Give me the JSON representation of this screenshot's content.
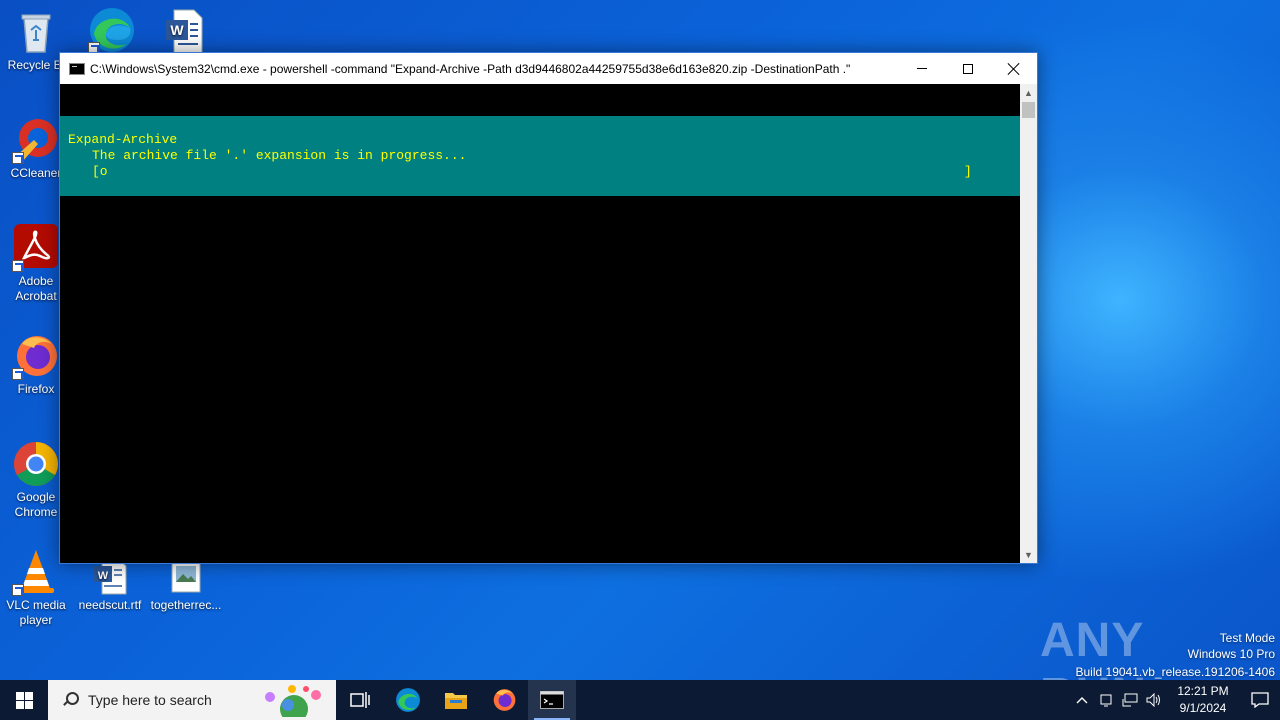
{
  "desktop": {
    "icons": [
      {
        "label": "Recycle Bin",
        "display": "Recycle Bi"
      },
      {
        "label": "Microsoft Edge",
        "display": ""
      },
      {
        "label": "Word document",
        "display": ""
      },
      {
        "label": "CCleaner",
        "display": "CCleaner"
      },
      {
        "label": "Adobe Acrobat",
        "display": "Adobe\nAcrobat"
      },
      {
        "label": "Firefox",
        "display": "Firefox"
      },
      {
        "label": "Google Chrome",
        "display": "Google\nChrome"
      },
      {
        "label": "VLC media player",
        "display": "VLC media\nplayer"
      },
      {
        "label": "needscut.rtf",
        "display": "needscut.rtf"
      },
      {
        "label": "togetherrec...",
        "display": "togetherrec..."
      }
    ]
  },
  "window": {
    "title": "C:\\Windows\\System32\\cmd.exe - powershell  -command \"Expand-Archive -Path d3d9446802a44259755d38e6d163e820.zip -DestinationPath .\"",
    "controls": {
      "minimize": "Minimize",
      "maximize": "Maximize",
      "close": "Close"
    }
  },
  "console": {
    "progress_title": "Expand-Archive",
    "progress_status": "The archive file '.' expansion is in progress...",
    "progress_bar_left": "[o",
    "progress_bar_right": "]",
    "progress_fraction": 0.0
  },
  "watermark": {
    "brand": "ANY RUN",
    "line1": "Test Mode",
    "line2": "Windows 10 Pro",
    "line3": "Build 19041.vb_release.191206-1406"
  },
  "taskbar": {
    "search_placeholder": "Type here to search",
    "apps": [
      "Task View",
      "Microsoft Edge",
      "File Explorer",
      "Firefox",
      "Command Prompt"
    ],
    "clock_time": "12:21 PM",
    "clock_date": "9/1/2024"
  },
  "colors": {
    "console_progress_bg": "#008080",
    "console_progress_fg": "#ffff00",
    "taskbar_bg": "#0c1b33"
  }
}
